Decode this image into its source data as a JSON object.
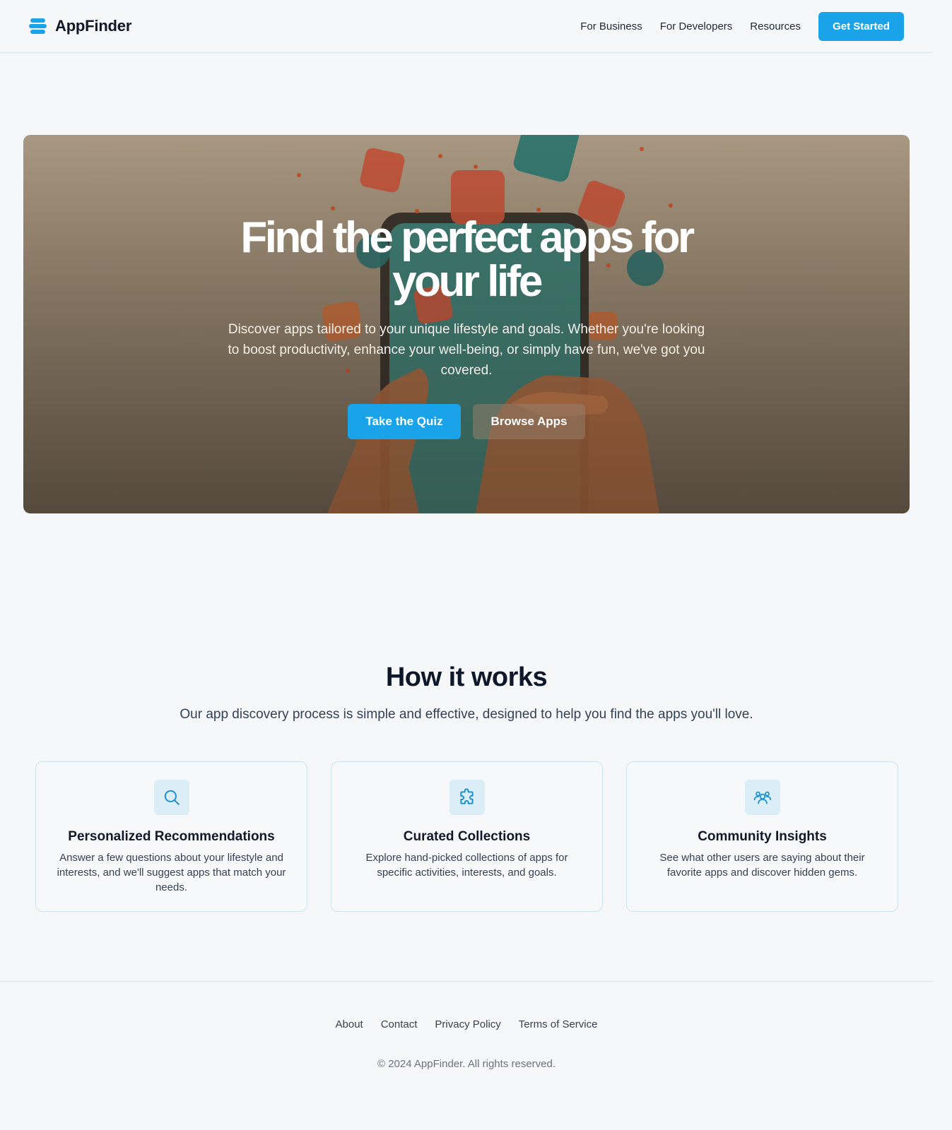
{
  "header": {
    "brand": "AppFinder",
    "brand_icon": "stacked-layers-icon",
    "nav": [
      "For Business",
      "For Developers",
      "Resources"
    ],
    "cta": "Get Started"
  },
  "hero": {
    "title": "Find the perfect apps for your life",
    "subtitle": "Discover apps tailored to your unique lifestyle and goals. Whether you're looking to boost productivity, enhance your well-being, or simply have fun, we've got you covered.",
    "primary_button": "Take the Quiz",
    "secondary_button": "Browse Apps",
    "background_image": "hands-holding-phone-with-floating-app-icons"
  },
  "how": {
    "title": "How it works",
    "subtitle": "Our app discovery process is simple and effective, designed to help you find the apps you'll love.",
    "cards": [
      {
        "icon": "search-icon",
        "title": "Personalized Recommendations",
        "description": "Answer a few questions about your lifestyle and interests, and we'll suggest apps that match your needs."
      },
      {
        "icon": "puzzle-icon",
        "title": "Curated Collections",
        "description": "Explore hand-picked collections of apps for specific activities, interests, and goals."
      },
      {
        "icon": "users-icon",
        "title": "Community Insights",
        "description": "See what other users are saying about their favorite apps and discover hidden gems."
      }
    ]
  },
  "footer": {
    "links": [
      "About",
      "Contact",
      "Privacy Policy",
      "Terms of Service"
    ],
    "copyright": "© 2024 AppFinder. All rights reserved."
  },
  "colors": {
    "accent": "#1aa3e8",
    "background": "#f5f7f9",
    "card_border": "#cfe3ec",
    "icon_tile": "#dbeef7"
  }
}
